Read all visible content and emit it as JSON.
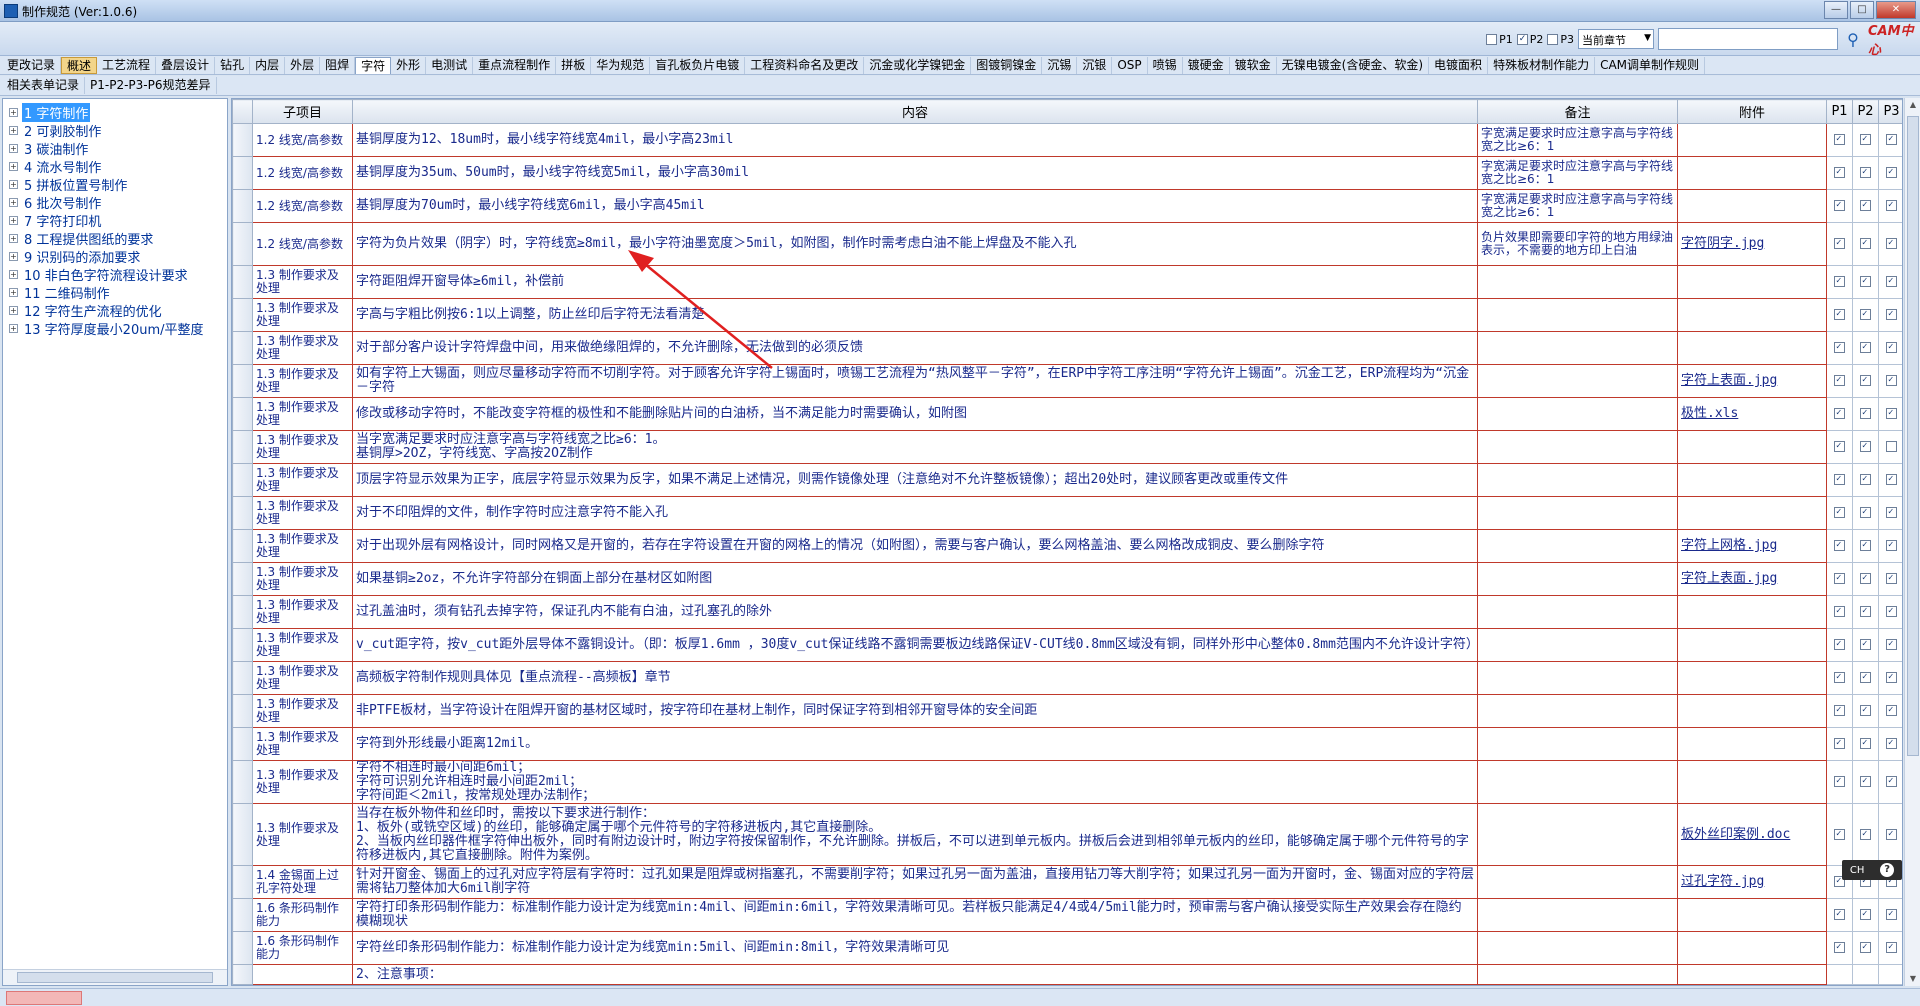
{
  "window": {
    "title": "制作规范 (Ver:1.0.6)"
  },
  "toolbar": {
    "p1_label": "P1",
    "p2_label": "P2",
    "p3_label": "P3",
    "chapter_select": "当前章节",
    "search_placeholder": "",
    "brand": "CAM中心"
  },
  "tabs_row1": [
    "更改记录",
    "概述",
    "工艺流程",
    "叠层设计",
    "钻孔",
    "内层",
    "外层",
    "阻焊",
    "字符",
    "外形",
    "电测试",
    "重点流程制作",
    "拼板",
    "华为规范",
    "盲孔板负片电镀",
    "工程资料命名及更改",
    "沉金或化学镍钯金",
    "图镀铜镍金",
    "沉锡",
    "沉银",
    "OSP",
    "喷锡",
    "镀硬金",
    "镀软金",
    "无镍电镀金(含硬金、软金)",
    "电镀面积",
    "特殊板材制作能力",
    "CAM调单制作规则"
  ],
  "tabs_row2": [
    "相关表单记录",
    "P1-P2-P3-P6规范差异"
  ],
  "tree": {
    "items": [
      "1 字符制作",
      "2 可剥胶制作",
      "3 碳油制作",
      "4 流水号制作",
      "5 拼板位置号制作",
      "6 批次号制作",
      "7 字符打印机",
      "8 工程提供图纸的要求",
      "9 识别码的添加要求",
      "10 非白色字符流程设计要求",
      "11 二维码制作",
      "12 字符生产流程的优化",
      "13 字符厚度最小20um/平整度"
    ]
  },
  "grid": {
    "headers": {
      "sub": "子项目",
      "content": "内容",
      "note": "备注",
      "attach": "附件",
      "p1": "P1",
      "p2": "P2",
      "p3": "P3"
    },
    "rows": [
      {
        "sub": "1.2 线宽/高参数",
        "content": "基铜厚度为12、18um时，最小线字符线宽4mil，最小字高23mil",
        "note": "字宽满足要求时应注意字高与字符线宽之比≥6：1",
        "attach": "",
        "p": [
          true,
          true,
          true
        ]
      },
      {
        "sub": "1.2 线宽/高参数",
        "content": "基铜厚度为35um、50um时，最小线字符线宽5mil，最小字高30mil",
        "note": "字宽满足要求时应注意字高与字符线宽之比≥6：1",
        "attach": "",
        "p": [
          true,
          true,
          true
        ]
      },
      {
        "sub": "1.2 线宽/高参数",
        "content": "基铜厚度为70um时，最小线字符线宽6mil，最小字高45mil",
        "note": "字宽满足要求时应注意字高与字符线宽之比≥6：1",
        "attach": "",
        "p": [
          true,
          true,
          true
        ]
      },
      {
        "sub": "1.2 线宽/高参数",
        "content": "字符为负片效果（阴字）时，字符线宽≥8mil，最小字符油墨宽度＞5mil，如附图，制作时需考虑白油不能上焊盘及不能入孔",
        "note": "负片效果即需要印字符的地方用绿油表示，不需要的地方印上白油",
        "attach": "字符阴字.jpg",
        "p": [
          true,
          true,
          true
        ]
      },
      {
        "sub": "1.3 制作要求及处理",
        "content": "字符距阻焊开窗导体≥6mil，补偿前",
        "note": "",
        "attach": "",
        "p": [
          true,
          true,
          true
        ]
      },
      {
        "sub": "1.3 制作要求及处理",
        "content": "字高与字粗比例按6:1以上调整，防止丝印后字符无法看清楚",
        "note": "",
        "attach": "",
        "p": [
          true,
          true,
          true
        ]
      },
      {
        "sub": "1.3 制作要求及处理",
        "content": "对于部分客户设计字符焊盘中间，用来做绝缘阻焊的，不允许删除，无法做到的必须反馈",
        "note": "",
        "attach": "",
        "p": [
          true,
          true,
          true
        ]
      },
      {
        "sub": "1.3 制作要求及处理",
        "content": "如有字符上大锡面，则应尽量移动字符而不切削字符。对于顾客允许字符上锡面时，喷锡工艺流程为“热风整平－字符”，在ERP中字符工序注明“字符允许上锡面”。沉金工艺，ERP流程均为“沉金－字符",
        "note": "",
        "attach": "字符上表面.jpg",
        "p": [
          true,
          true,
          true
        ]
      },
      {
        "sub": "1.3 制作要求及处理",
        "content": "修改或移动字符时，不能改变字符框的极性和不能删除贴片间的白油桥，当不满足能力时需要确认，如附图",
        "note": "",
        "attach": "极性.xls",
        "p": [
          true,
          true,
          true
        ]
      },
      {
        "sub": "1.3 制作要求及处理",
        "content": "当字宽满足要求时应注意字高与字符线宽之比≥6：1。\n基铜厚>2OZ，字符线宽、字高按2OZ制作",
        "note": "",
        "attach": "",
        "p": [
          true,
          true,
          false
        ]
      },
      {
        "sub": "1.3 制作要求及处理",
        "content": "顶层字符显示效果为正字，底层字符显示效果为反字，如果不满足上述情况，则需作镜像处理（注意绝对不允许整板镜像）；超出20处时，建议顾客更改或重传文件",
        "note": "",
        "attach": "",
        "p": [
          true,
          true,
          true
        ]
      },
      {
        "sub": "1.3 制作要求及处理",
        "content": "对于不印阻焊的文件，制作字符时应注意字符不能入孔",
        "note": "",
        "attach": "",
        "p": [
          true,
          true,
          true
        ]
      },
      {
        "sub": "1.3 制作要求及处理",
        "content": "对于出现外层有网格设计，同时网格又是开窗的，若存在字符设置在开窗的网格上的情况（如附图），需要与客户确认，要么网格盖油、要么网格改成铜皮、要么删除字符",
        "note": "",
        "attach": "字符上网格.jpg",
        "p": [
          true,
          true,
          true
        ]
      },
      {
        "sub": "1.3 制作要求及处理",
        "content": "如果基铜≥2oz，不允许字符部分在铜面上部分在基材区如附图",
        "note": "",
        "attach": "字符上表面.jpg",
        "p": [
          true,
          true,
          true
        ]
      },
      {
        "sub": "1.3 制作要求及处理",
        "content": "过孔盖油时，须有钻孔去掉字符，保证孔内不能有白油，过孔塞孔的除外",
        "note": "",
        "attach": "",
        "p": [
          true,
          true,
          true
        ]
      },
      {
        "sub": "1.3 制作要求及处理",
        "content": "v_cut距字符，按v_cut距外层导体不露铜设计。（即：板厚1.6mm ，30度v_cut保证线路不露铜需要板边线路保证V-CUT线0.8mm区域没有铜，同样外形中心整体0.8mm范围内不允许设计字符）",
        "note": "",
        "attach": "",
        "p": [
          true,
          true,
          true
        ]
      },
      {
        "sub": "1.3 制作要求及处理",
        "content": "高频板字符制作规则具体见【重点流程--高频板】章节",
        "note": "",
        "attach": "",
        "p": [
          true,
          true,
          true
        ]
      },
      {
        "sub": "1.3 制作要求及处理",
        "content": "非PTFE板材，当字符设计在阻焊开窗的基材区域时，按字符印在基材上制作，同时保证字符到相邻开窗导体的安全间距",
        "note": "",
        "attach": "",
        "p": [
          true,
          true,
          true
        ]
      },
      {
        "sub": "1.3 制作要求及处理",
        "content": "字符到外形线最小距离12mil。",
        "note": "",
        "attach": "",
        "p": [
          true,
          true,
          true
        ]
      },
      {
        "sub": "1.3 制作要求及处理",
        "content": "字符不相连时最小间距6mil；\n字符可识别允许相连时最小间距2mil；\n字符间距＜2mil，按常规处理办法制作；",
        "note": "",
        "attach": "",
        "p": [
          true,
          true,
          true
        ]
      },
      {
        "sub": "1.3 制作要求及处理",
        "content": "当存在板外物件和丝印时，需按以下要求进行制作：\n1、板外(或铣空区域)的丝印，能够确定属于哪个元件符号的字符移进板内,其它直接删除。\n2、当板内丝印器件框字符伸出板外，同时有附边设计时，附边字符按保留制作，不允许删除。拼板后，不可以进到单元板内。拼板后会进到相邻单元板内的丝印，能够确定属于哪个元件符号的字符移进板内,其它直接删除。附件为案例。",
        "note": "",
        "attach": "板外丝印案例.doc",
        "p": [
          true,
          true,
          true
        ]
      },
      {
        "sub": "1.4 金锡面上过孔字符处理",
        "content": "针对开窗金、锡面上的过孔对应字符层有字符时：过孔如果是阻焊或树指塞孔，不需要削字符；如果过孔另一面为盖油，直接用钻刀等大削字符；如果过孔另一面为开窗时，金、锡面对应的字符层需将钻刀整体加大6mil削字符",
        "note": "",
        "attach": "过孔字符.jpg",
        "p": [
          true,
          true,
          true
        ]
      },
      {
        "sub": "1.6 条形码制作能力",
        "content": "字符打印条形码制作能力：标准制作能力设计定为线宽min:4mil、间距min:6mil，字符效果清晰可见。若样板只能满足4/4或4/5mil能力时，预审需与客户确认接受实际生产效果会存在隐约模糊现状",
        "note": "",
        "attach": "",
        "p": [
          true,
          true,
          true
        ]
      },
      {
        "sub": "1.6 条形码制作能力",
        "content": "字符丝印条形码制作能力：标准制作能力设计定为线宽min:5mil、间距min:8mil，字符效果清晰可见",
        "note": "",
        "attach": "",
        "p": [
          true,
          true,
          true
        ]
      },
      {
        "sub": "",
        "content": "2、注意事项：",
        "note": "",
        "attach": "",
        "p": [
          false,
          false,
          false
        ]
      }
    ]
  },
  "ime": {
    "label": "CH",
    "help": "?"
  }
}
